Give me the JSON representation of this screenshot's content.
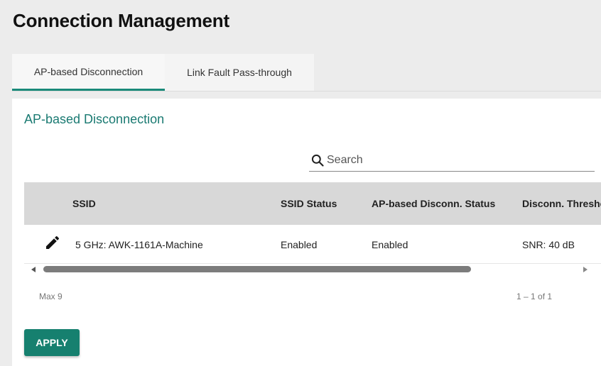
{
  "page": {
    "title": "Connection Management"
  },
  "tabs": [
    {
      "label": "AP-based Disconnection",
      "active": true
    },
    {
      "label": "Link Fault Pass-through",
      "active": false
    }
  ],
  "card": {
    "title": "AP-based Disconnection"
  },
  "search": {
    "placeholder": "Search",
    "value": "",
    "icon": "search-icon"
  },
  "table": {
    "columns": [
      "SSID",
      "SSID Status",
      "AP-based Disconn. Status",
      "Disconn. Threshold"
    ],
    "rows": [
      {
        "ssid": "5 GHz: AWK-1161A-Machine",
        "ssid_status": "Enabled",
        "ap_status": "Enabled",
        "threshold": "SNR: 40 dB",
        "icon": "edit-icon"
      }
    ]
  },
  "footer": {
    "max": "Max 9",
    "pagination": "1 – 1 of 1"
  },
  "actions": {
    "apply_label": "APPLY"
  },
  "colors": {
    "accent": "#16806f",
    "title_teal": "#1a7a72",
    "header_bg": "#d8d8d8"
  }
}
